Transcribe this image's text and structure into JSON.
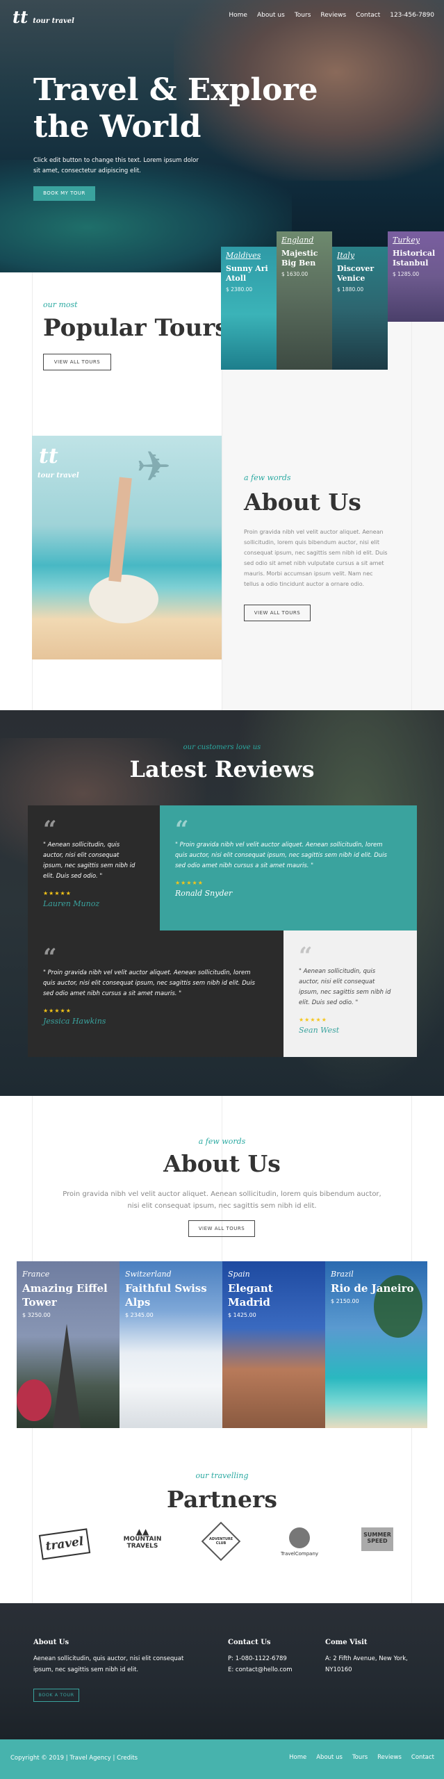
{
  "brand": {
    "mark": "tt",
    "name": "tour travel"
  },
  "nav": [
    "Home",
    "About us",
    "Tours",
    "Reviews",
    "Contact"
  ],
  "phone": "123-456-7890",
  "hero": {
    "title_line1": "Travel & Explore",
    "title_line2": "the World",
    "text_line1": "Click edit button to change this text. Lorem ipsum dolor",
    "text_line2": "sit amet, consectetur adipiscing elit.",
    "button": "BOOK MY TOUR"
  },
  "popular": {
    "kicker": "our most",
    "title": "Popular Tours",
    "button": "VIEW ALL TOURS",
    "cards": [
      {
        "country": "Maldives",
        "title_l1": "Sunny Ari",
        "title_l2": "Atoll",
        "price": "$ 2380.00"
      },
      {
        "country": "England",
        "title_l1": "Majestic",
        "title_l2": "Big Ben",
        "price": "$ 1630.00"
      },
      {
        "country": "Italy",
        "title_l1": "Discover",
        "title_l2": "Venice",
        "price": "$ 1880.00"
      },
      {
        "country": "Turkey",
        "title_l1": "Historical",
        "title_l2": "Istanbul",
        "price": "$ 1285.00"
      }
    ]
  },
  "about1": {
    "kicker": "a few words",
    "title": "About Us",
    "lines": [
      "Proin gravida nibh vel velit auctor aliquet. Aenean",
      "sollicitudin, lorem quis bibendum auctor, nisi elit",
      "consequat ipsum, nec sagittis sem nibh id elit. Duis",
      "sed odio sit amet nibh vulputate cursus a sit amet",
      "mauris. Morbi accumsan ipsum velit. Nam nec",
      "tellus a odio tincidunt auctor a ornare odio."
    ],
    "button": "VIEW ALL TOURS",
    "img_mark": "tt",
    "img_name": "tour travel"
  },
  "reviews": {
    "kicker": "our customers love us",
    "title": "Latest Reviews",
    "items": [
      {
        "lines": [
          "\" Aenean sollicitudin, quis",
          "auctor, nisi elit consequat",
          "ipsum, nec sagittis sem nibh id",
          "elit. Duis sed odio. \""
        ],
        "stars": "★★★★★",
        "name": "Lauren Munoz"
      },
      {
        "lines": [
          "\" Proin gravida nibh vel velit auctor aliquet. Aenean sollicitudin, lorem",
          "quis auctor, nisi elit consequat ipsum, nec sagittis sem nibh id elit. Duis",
          "sed odio amet nibh cursus a sit amet mauris. \""
        ],
        "stars": "★★★★★",
        "name": "Ronald Snyder"
      },
      {
        "lines": [
          "\" Proin gravida nibh vel velit auctor aliquet. Aenean sollicitudin, lorem",
          "quis auctor, nisi elit consequat ipsum, nec sagittis sem nibh id elit. Duis",
          "sed odio amet nibh cursus a sit amet mauris. \""
        ],
        "stars": "★★★★★",
        "name": "Jessica Hawkins"
      },
      {
        "lines": [
          "\" Aenean sollicitudin, quis",
          "auctor, nisi elit consequat",
          "ipsum, nec sagittis sem nibh id",
          "elit. Duis sed odio. \""
        ],
        "stars": "★★★★★",
        "name": "Sean West"
      }
    ]
  },
  "about2": {
    "kicker": "a few words",
    "title": "About Us",
    "line1": "Proin gravida nibh vel velit auctor aliquet. Aenean sollicitudin, lorem quis bibendum auctor,",
    "line2": "nisi elit consequat ipsum, nec sagittis sem nibh id elit.",
    "button": "VIEW ALL TOURS"
  },
  "destinations": [
    {
      "country": "France",
      "title_l1": "Amazing Eiffel",
      "title_l2": "Tower",
      "price": "$ 3250.00"
    },
    {
      "country": "Switzerland",
      "title_l1": "Faithful Swiss",
      "title_l2": "Alps",
      "price": "$ 2345.00"
    },
    {
      "country": "Spain",
      "title_l1": "Elegant",
      "title_l2": "Madrid",
      "price": "$ 1425.00"
    },
    {
      "country": "Brazil",
      "title_l1": "Rio de Janeiro",
      "title_l2": "",
      "price": "$ 2150.00"
    }
  ],
  "partners": {
    "kicker": "our travelling",
    "title": "Partners",
    "logos": [
      {
        "l1": "travel",
        "l2": ""
      },
      {
        "l1": "MOUNTAIN",
        "l2": "TRAVELS"
      },
      {
        "l1": "ADVENTURE",
        "l2": "CLUB"
      },
      {
        "l1": "TravelCompany",
        "l2": ""
      },
      {
        "l1": "SUMMER",
        "l2": "SPEED"
      }
    ]
  },
  "footer": {
    "about_title": "About Us",
    "about_l1": "Aenean sollicitudin, quis auctor, nisi elit consequat",
    "about_l2": "ipsum, nec sagittis sem nibh id elit.",
    "button": "BOOK A TOUR",
    "contact_title": "Contact Us",
    "phone": "P: 1-080-1122-6789",
    "email": "E: contact@hello.com",
    "visit_title": "Come Visit",
    "addr_l1": "A: 2 Fifth Avenue, New York,",
    "addr_l2": "NY10160",
    "copyright": "Copyright © 2019 | Travel Agency | Credits",
    "links": [
      "Home",
      "About us",
      "Tours",
      "Reviews",
      "Contact"
    ]
  },
  "colors": {
    "teal": "#3aa39e",
    "dark": "#2b2b2b",
    "footer_bar": "#47b3ad"
  }
}
